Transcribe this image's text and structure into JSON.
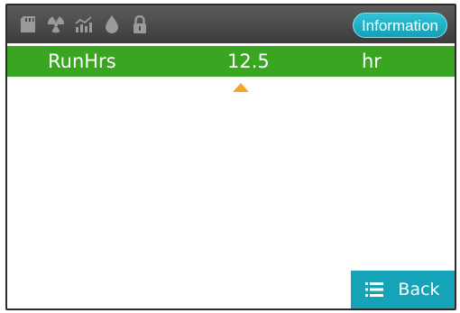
{
  "status_icons": [
    "sd-card-icon",
    "radiation-icon",
    "trend-chart-icon",
    "water-drop-icon",
    "lock-icon"
  ],
  "header": {
    "info_label": "Information"
  },
  "parameter": {
    "name": "RunHrs",
    "value": "12.5",
    "unit": "hr"
  },
  "footer": {
    "back_label": "Back"
  },
  "colors": {
    "topbar": "#4a4a4a",
    "row_green": "#3aa521",
    "accent_teal": "#15a3b7",
    "caret_orange": "#f5a623",
    "icon_gray": "#9a9a9a"
  }
}
